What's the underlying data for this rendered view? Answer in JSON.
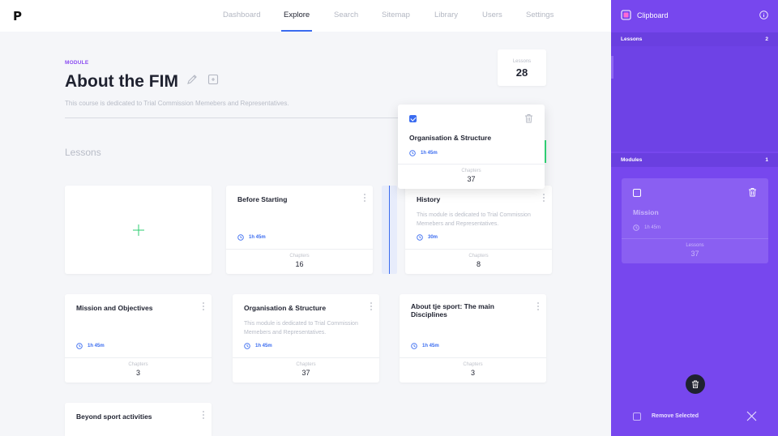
{
  "app": {
    "logo": "P"
  },
  "nav": {
    "items": [
      {
        "label": "Dashboard",
        "active": false
      },
      {
        "label": "Explore",
        "active": true
      },
      {
        "label": "Search",
        "active": false
      },
      {
        "label": "Sitemap",
        "active": false
      },
      {
        "label": "Library",
        "active": false
      },
      {
        "label": "Users",
        "active": false
      },
      {
        "label": "Settings",
        "active": false
      }
    ]
  },
  "module": {
    "label": "MODULE",
    "title": "About the FIM",
    "description": "This course is dedicated to Trial Commission Memebers and Representatives.",
    "lessons_label": "Lessons",
    "lessons_count": "28",
    "section_heading": "Lessons"
  },
  "cards": [
    {
      "title": "Before Starting",
      "description": "",
      "time": "1h 45m",
      "footer_label": "Chapters",
      "footer_value": "16"
    },
    {
      "title": "History",
      "description": "This module is dedicated to Trial Commission Memebers and Representatives.",
      "time": "30m",
      "footer_label": "Chapters",
      "footer_value": "8"
    },
    {
      "title": "Mission and Objectives",
      "description": "",
      "time": "1h 45m",
      "footer_label": "Chapters",
      "footer_value": "3"
    },
    {
      "title": "Organisation & Structure",
      "description": "This module is dedicated to Trial Commission Memebers and Representatives.",
      "time": "1h 45m",
      "footer_label": "Chapters",
      "footer_value": "37"
    },
    {
      "title": "About tje sport:  The main Disciplines",
      "description": "",
      "time": "1h 45m",
      "footer_label": "Chapters",
      "footer_value": "3"
    },
    {
      "title": "Beyond sport activities",
      "description": "",
      "time": "",
      "footer_label": "",
      "footer_value": ""
    }
  ],
  "dragged_card": {
    "title": "Organisation & Structure",
    "time": "1h 45m",
    "footer_label": "Chapters",
    "footer_value": "37"
  },
  "sidebar": {
    "title": "Clipboard",
    "lessons_bar": {
      "label": "Lessons",
      "count": "2"
    },
    "modules_bar": {
      "label": "Modules",
      "count": "1"
    },
    "module_card": {
      "title": "Mission",
      "time": "1h 45m",
      "footer_label": "Lessons",
      "footer_value": "37"
    },
    "remove_label": "Remove Selected"
  },
  "colors": {
    "accent": "#3b6cf0",
    "sidebar": "#7747ee",
    "module_label": "#8a4bf2"
  },
  "icons": [
    "edit-icon",
    "note-icon",
    "clock-icon",
    "trash-icon",
    "info-icon",
    "clipboard-icon",
    "close-icon",
    "plus-icon",
    "more-vertical-icon"
  ]
}
